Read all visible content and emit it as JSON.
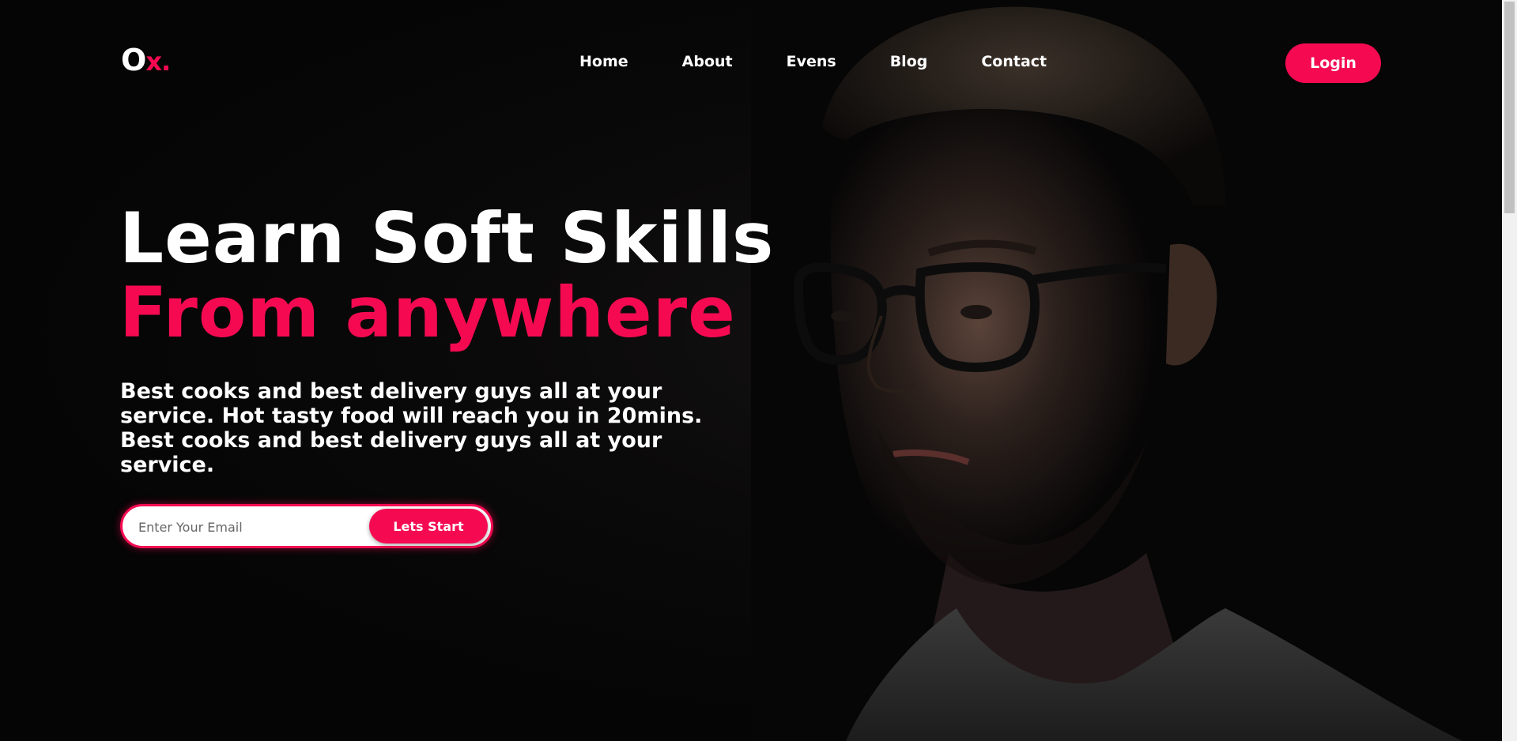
{
  "logo": {
    "main": "O",
    "accent": "x."
  },
  "nav": {
    "items": [
      "Home",
      "About",
      "Evens",
      "Blog",
      "Contact"
    ]
  },
  "header": {
    "login_label": "Login"
  },
  "hero": {
    "headline_line1": "Learn Soft Skills",
    "headline_line2": "From anywhere",
    "description": "Best cooks and best delivery guys all at your service. Hot tasty food will reach you in 20mins. Best cooks and best delivery guys all at your service.",
    "email_placeholder": "Enter Your Email",
    "start_label": "Lets Start"
  },
  "colors": {
    "accent": "#f50a52",
    "background": "#050505",
    "text": "#ffffff"
  },
  "icons": {
    "hero_image": "man-with-glasses-portrait"
  }
}
